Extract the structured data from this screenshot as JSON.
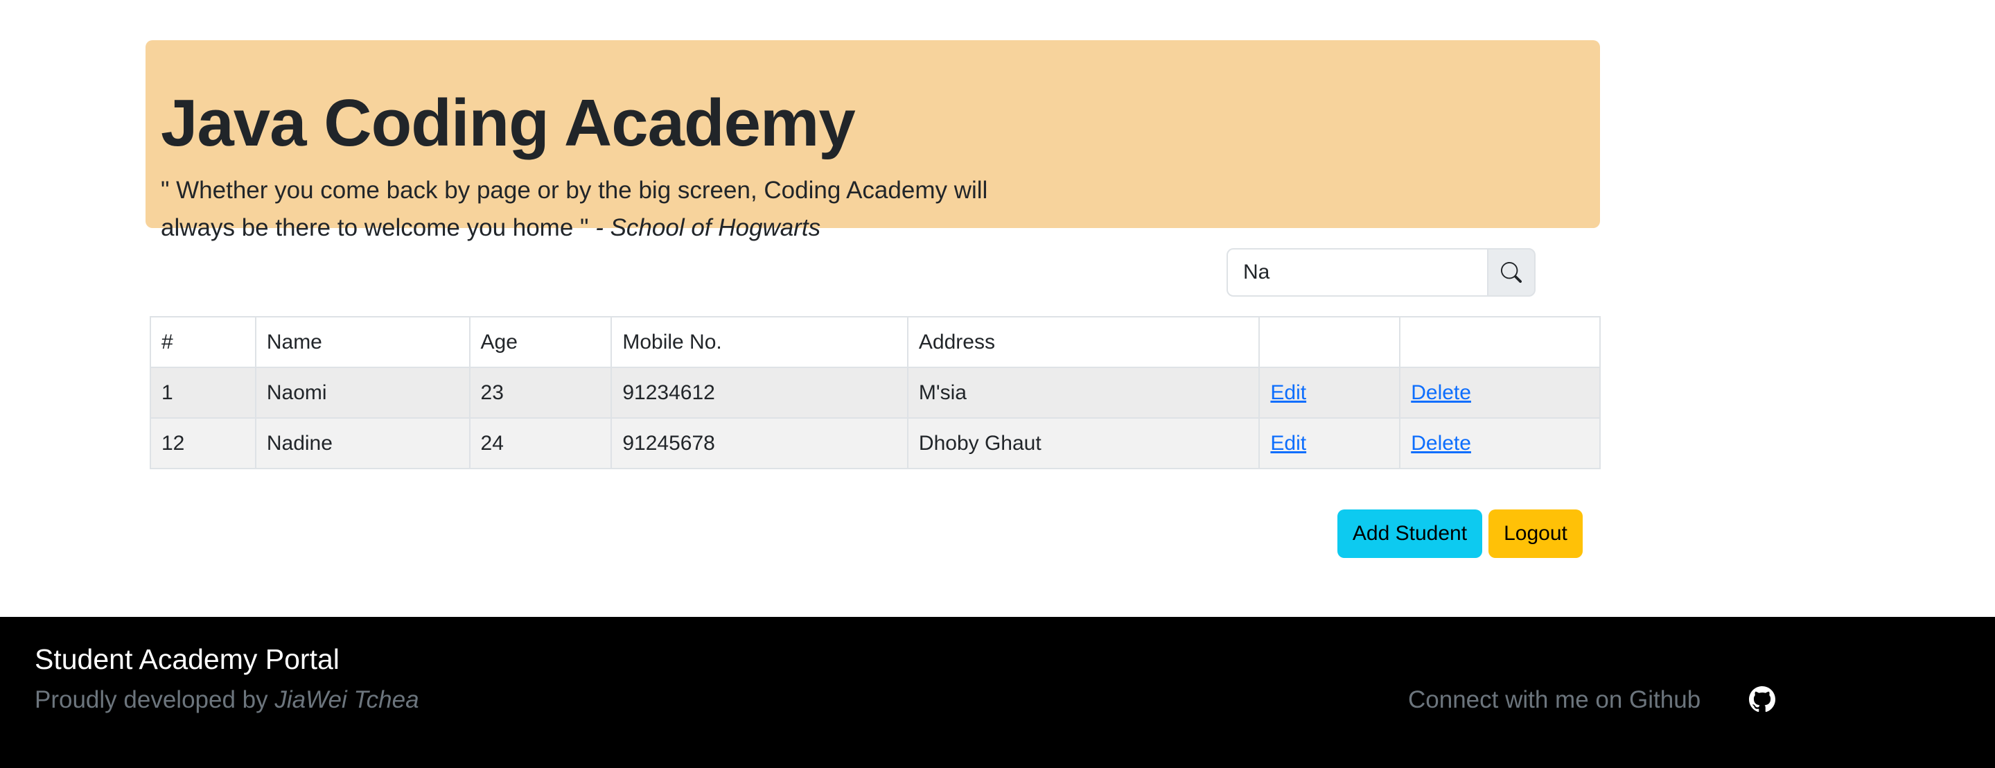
{
  "hero": {
    "title": "Java Coding Academy",
    "quote": "\" Whether you come back by page or by the big screen, Coding Academy will always be there to welcome you home \"",
    "attribution": "- School of Hogwarts",
    "background_color": "#f7d39c"
  },
  "search": {
    "value": "Na",
    "icon": "search-icon"
  },
  "table": {
    "headers": [
      "#",
      "Name",
      "Age",
      "Mobile No.",
      "Address",
      "",
      ""
    ],
    "rows": [
      {
        "id": "1",
        "name": "Naomi",
        "age": "23",
        "mobile": "91234612",
        "address": "M'sia",
        "edit": "Edit",
        "delete": "Delete"
      },
      {
        "id": "12",
        "name": "Nadine",
        "age": "24",
        "mobile": "91245678",
        "address": "Dhoby Ghaut",
        "edit": "Edit",
        "delete": "Delete"
      }
    ]
  },
  "actions": {
    "add_student": "Add Student",
    "logout": "Logout",
    "add_color": "#0dcaf0",
    "logout_color": "#ffc107"
  },
  "footer": {
    "title": "Student Academy Portal",
    "credit_prefix": "Proudly developed by",
    "credit_author": "JiaWei Tchea",
    "connect_text": "Connect with me on Github",
    "github_icon": "github-icon"
  }
}
